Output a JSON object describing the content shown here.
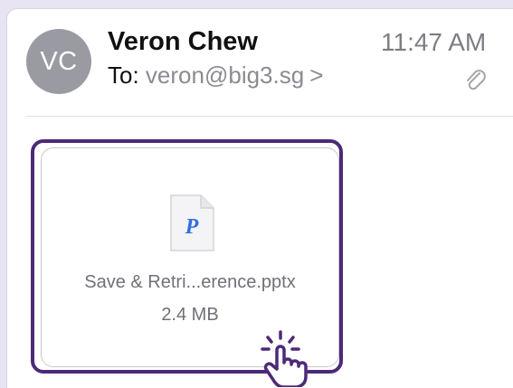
{
  "message": {
    "avatar_initials": "VC",
    "sender_name": "Veron Chew",
    "to_label": "To:",
    "to_email": "veron@big3.sg",
    "to_chevron": ">",
    "time": "11:47 AM"
  },
  "attachment": {
    "file_icon_letter": "P",
    "file_name": "Save & Retri...erence.pptx",
    "file_size": "2.4 MB"
  },
  "icons": {
    "paperclip": "paperclip-icon",
    "file": "powerpoint-file-icon",
    "pointer": "hand-pointer-icon"
  },
  "colors": {
    "highlight": "#4c2a78",
    "file_letter": "#2f6fe0"
  }
}
